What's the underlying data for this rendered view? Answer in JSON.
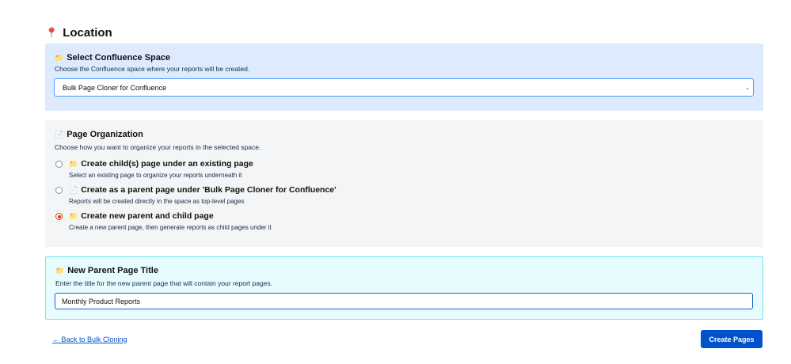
{
  "page": {
    "heading": "Location",
    "heading_icon": "📍"
  },
  "space_section": {
    "icon": "📁",
    "title": "Select Confluence Space",
    "description": "Choose the Confluence space where your reports will be created.",
    "selected_value": "Bulk Page Cloner for Confluence",
    "chevron": "⌄"
  },
  "organization_section": {
    "icon": "📄",
    "title": "Page Organization",
    "description": "Choose how you want to organize your reports in the selected space.",
    "options": [
      {
        "icon": "📁",
        "label": "Create child(s) page under an existing page",
        "description": "Select an existing page to organize your reports underneath it",
        "selected": false
      },
      {
        "icon": "📄",
        "label": "Create as a parent page under 'Bulk Page Cloner for Confluence'",
        "description": "Reports will be created directly in the space as top-level pages",
        "selected": false
      },
      {
        "icon": "📁",
        "label": "Create new parent and child page",
        "description": "Create a new parent page, then generate reports as child pages under it",
        "selected": true
      }
    ]
  },
  "parent_title_section": {
    "icon": "📁",
    "title": "New Parent Page Title",
    "description": "Enter the title for the new parent page that will contain your report pages.",
    "input_value": "Monthly Product Reports"
  },
  "footer": {
    "back_link": "← Back to Bulk Cloning",
    "create_button": "Create Pages"
  },
  "colors": {
    "primary": "#0052cc",
    "space_panel_bg": "#deebff",
    "org_panel_bg": "#f4f5f7",
    "title_panel_bg": "#e6fcff",
    "radio_selected": "#de350b"
  }
}
